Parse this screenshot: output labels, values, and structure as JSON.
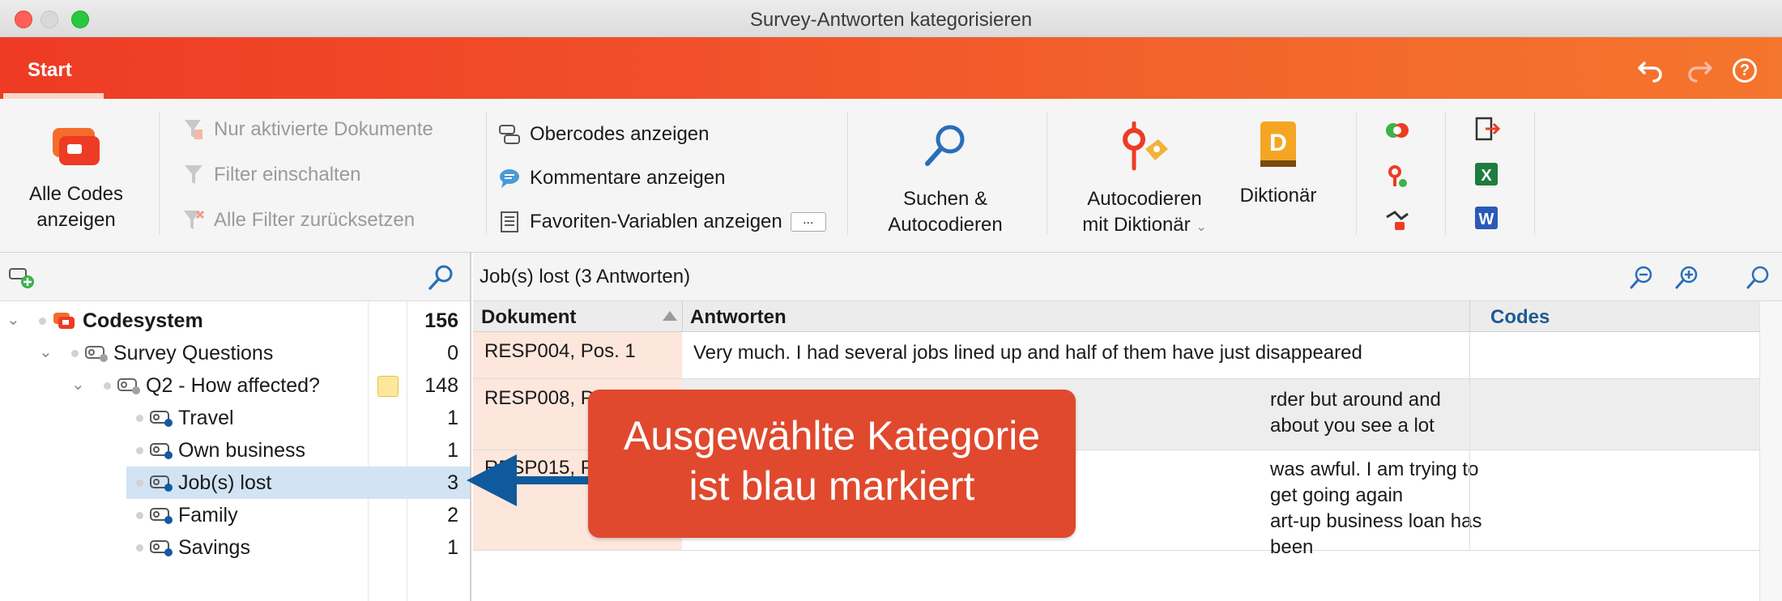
{
  "window": {
    "title": "Survey-Antworten kategorisieren"
  },
  "ribbon_tabs": {
    "start": "Start"
  },
  "ribbon": {
    "all_codes": {
      "line1": "Alle Codes",
      "line2": "anzeigen"
    },
    "filters": {
      "only_active_docs": "Nur aktivierte Dokumente",
      "filter_on": "Filter einschalten",
      "reset_filters": "Alle Filter zurücksetzen"
    },
    "show": {
      "parent_codes": "Obercodes anzeigen",
      "comments": "Kommentare anzeigen",
      "favorite_vars": "Favoriten-Variablen anzeigen",
      "more": "..."
    },
    "search": {
      "line1": "Suchen &",
      "line2": "Autocodieren"
    },
    "autocode": {
      "line1": "Autocodieren",
      "line2": "mit Diktionär"
    },
    "dictionary": {
      "label": "Diktionär"
    }
  },
  "code_tree": {
    "rows": [
      {
        "name": "Codesystem",
        "count": "156"
      },
      {
        "name": "Survey Questions",
        "count": "0"
      },
      {
        "name": "Q2 - How affected?",
        "count": "148"
      },
      {
        "name": "Travel",
        "count": "1"
      },
      {
        "name": "Own business",
        "count": "1"
      },
      {
        "name": "Job(s) lost",
        "count": "3"
      },
      {
        "name": "Family",
        "count": "2"
      },
      {
        "name": "Savings",
        "count": "1"
      }
    ]
  },
  "segment_view": {
    "title": "Job(s) lost (3 Antworten)",
    "columns": {
      "document": "Dokument",
      "answers": "Antworten",
      "codes": "Codes"
    },
    "rows": [
      {
        "document": "RESP004, Pos. 1",
        "answer_l1": "Very much. I had several jobs lined up and half of them have just disappeared",
        "answer_l2": ""
      },
      {
        "document": "RESP008, P",
        "answer_l1": "rder but around and about you see a lot",
        "answer_l2": ""
      },
      {
        "document": "RESP015, P",
        "answer_l1": "was awful. I am trying to get going again",
        "answer_l2": "art-up business loan has been"
      }
    ]
  },
  "callout": {
    "line1": "Ausgewählte Kategorie",
    "line2": "ist blau markiert"
  },
  "colors": {
    "accent_orange": "#ee3b24",
    "selection_blue": "#d2e3f4",
    "callout_red": "#e0492d",
    "arrow_blue": "#0f5a9c"
  }
}
